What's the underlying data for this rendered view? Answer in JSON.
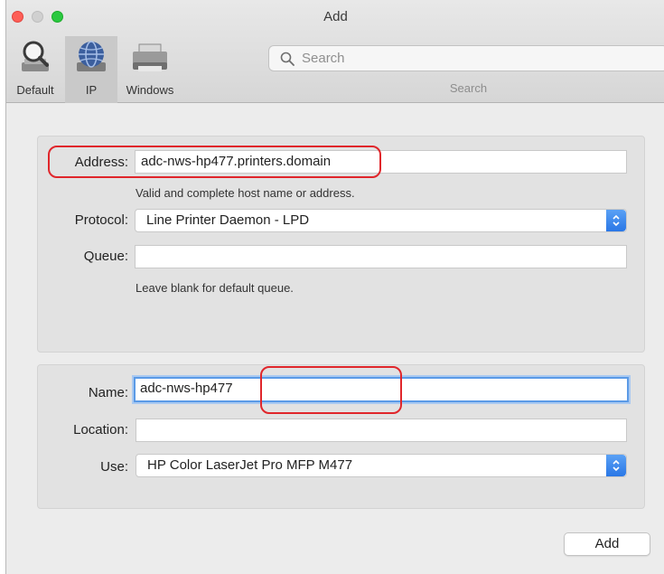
{
  "window": {
    "title": "Add",
    "colors": {
      "close": "#fe5f57",
      "minimize": "#d0d0d0",
      "zoom": "#2bc840",
      "annotation": "#e0262b",
      "accent": "#2a77e6"
    }
  },
  "toolbar": {
    "items": [
      {
        "label": "Default",
        "icon": "magnifier-printer-icon",
        "selected": false
      },
      {
        "label": "IP",
        "icon": "globe-icon",
        "selected": true
      },
      {
        "label": "Windows",
        "icon": "printer-icon",
        "selected": false
      }
    ],
    "search": {
      "placeholder": "Search",
      "label": "Search"
    }
  },
  "connection": {
    "address_label": "Address:",
    "address_value": "adc-nws-hp477.printers.domain",
    "address_hint": "Valid and complete host name or address.",
    "protocol_label": "Protocol:",
    "protocol_value": "Line Printer Daemon - LPD",
    "queue_label": "Queue:",
    "queue_value": "",
    "queue_hint": "Leave blank for default queue."
  },
  "details": {
    "name_label": "Name:",
    "name_value": "adc-nws-hp477",
    "location_label": "Location:",
    "location_value": "",
    "use_label": "Use:",
    "use_value": "HP Color LaserJet Pro MFP M477"
  },
  "actions": {
    "add_label": "Add"
  }
}
